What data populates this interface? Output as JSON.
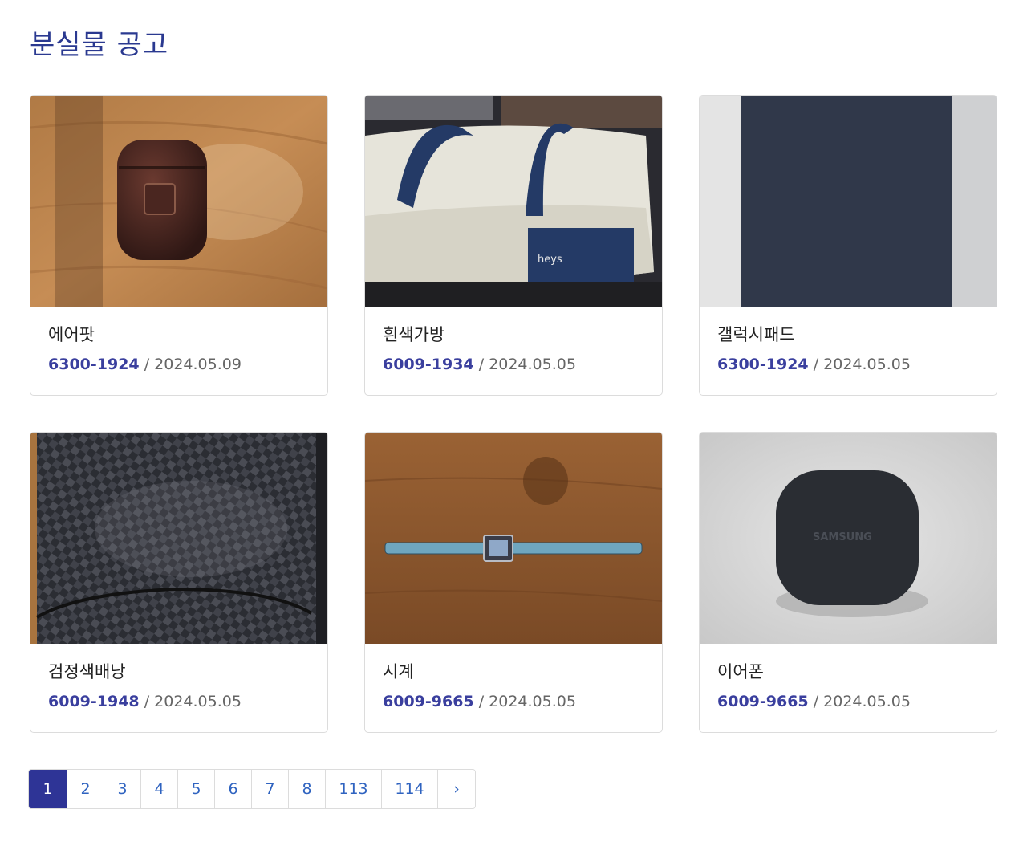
{
  "page": {
    "title": "분실물 공고"
  },
  "items": [
    {
      "name": "에어팟",
      "phone": "6300-1924",
      "separator": " / ",
      "date": "2024.05.09",
      "image": "airpods-case-photo"
    },
    {
      "name": "흰색가방",
      "phone": "6009-1934",
      "separator": " / ",
      "date": "2024.05.05",
      "image": "white-duffel-bag-photo",
      "brand_text": "heys"
    },
    {
      "name": "갤럭시패드",
      "phone": "6300-1924",
      "separator": " / ",
      "date": "2024.05.05",
      "image": "tablet-photo"
    },
    {
      "name": "검정색배낭",
      "phone": "6009-1948",
      "separator": " / ",
      "date": "2024.05.05",
      "image": "black-woven-backpack-photo"
    },
    {
      "name": "시계",
      "phone": "6009-9665",
      "separator": " / ",
      "date": "2024.05.05",
      "image": "wristwatch-photo"
    },
    {
      "name": "이어폰",
      "phone": "6009-9665",
      "separator": " / ",
      "date": "2024.05.05",
      "image": "earbuds-case-photo",
      "brand_text": "SAMSUNG"
    }
  ],
  "pagination": {
    "pages": [
      "1",
      "2",
      "3",
      "4",
      "5",
      "6",
      "7",
      "8",
      "113",
      "114"
    ],
    "current": "1",
    "next_label": "›"
  },
  "colors": {
    "title": "#2a3990",
    "phone": "#3a3f9e",
    "active_page": "#2e3496",
    "page_link": "#2f63c0"
  }
}
